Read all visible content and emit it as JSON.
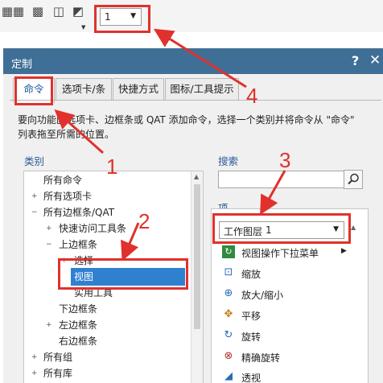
{
  "toolbar": {
    "icons": [
      "grid-icon",
      "textured-grid-icon",
      "cube-icon",
      "view-cube-icon"
    ],
    "layer_select_value": "1"
  },
  "dialog": {
    "title": "定制",
    "help": "?",
    "close": "✕",
    "tabs": [
      {
        "label": "命令",
        "active": true
      },
      {
        "label": "选项卡/条",
        "active": false
      },
      {
        "label": "快捷方式",
        "active": false
      },
      {
        "label": "图标/工具提示",
        "active": false
      }
    ],
    "description_line1": "要向功能区选项卡、边框条或 QAT 添加命令，选择一个类别并将命令从 \"命令\"",
    "description_line2": "列表拖至所需的位置。",
    "categories_label": "类别",
    "tree": [
      {
        "label": "所有命令",
        "depth": 0,
        "expander": ""
      },
      {
        "label": "所有选项卡",
        "depth": 0,
        "expander": "+"
      },
      {
        "label": "所有边框条/QAT",
        "depth": 0,
        "expander": "−"
      },
      {
        "label": "快速访问工具条",
        "depth": 1,
        "expander": "+"
      },
      {
        "label": "上边框条",
        "depth": 1,
        "expander": "−"
      },
      {
        "label": "选择",
        "depth": 2,
        "expander": "+"
      },
      {
        "label": "视图",
        "depth": 2,
        "expander": "",
        "selected": true
      },
      {
        "label": "实用工具",
        "depth": 2,
        "expander": ""
      },
      {
        "label": "下边框条",
        "depth": 1,
        "expander": ""
      },
      {
        "label": "左边框条",
        "depth": 1,
        "expander": "+"
      },
      {
        "label": "右边框条",
        "depth": 1,
        "expander": ""
      },
      {
        "label": "所有组",
        "depth": 0,
        "expander": "+"
      },
      {
        "label": "所有库",
        "depth": 0,
        "expander": "+"
      }
    ],
    "search_label": "搜索",
    "search_value": "",
    "items_label": "项",
    "layer_label": "工作图层",
    "layer_value": "1",
    "items": [
      {
        "label": "视图操作下拉菜单",
        "icon": "refresh-view-icon",
        "has_submenu": true
      },
      {
        "label": "缩放",
        "icon": "zoom-icon",
        "has_submenu": false
      },
      {
        "label": "放大/缩小",
        "icon": "zoom-in-out-icon",
        "has_submenu": false
      },
      {
        "label": "平移",
        "icon": "pan-icon",
        "has_submenu": false
      },
      {
        "label": "旋转",
        "icon": "rotate-icon",
        "has_submenu": false
      },
      {
        "label": "精确旋转",
        "icon": "precise-rotate-icon",
        "has_submenu": false
      },
      {
        "label": "透视",
        "icon": "perspective-icon",
        "has_submenu": false
      }
    ]
  },
  "annotations": {
    "color": "#e0312c",
    "numbers": [
      "1",
      "2",
      "3",
      "4"
    ]
  }
}
